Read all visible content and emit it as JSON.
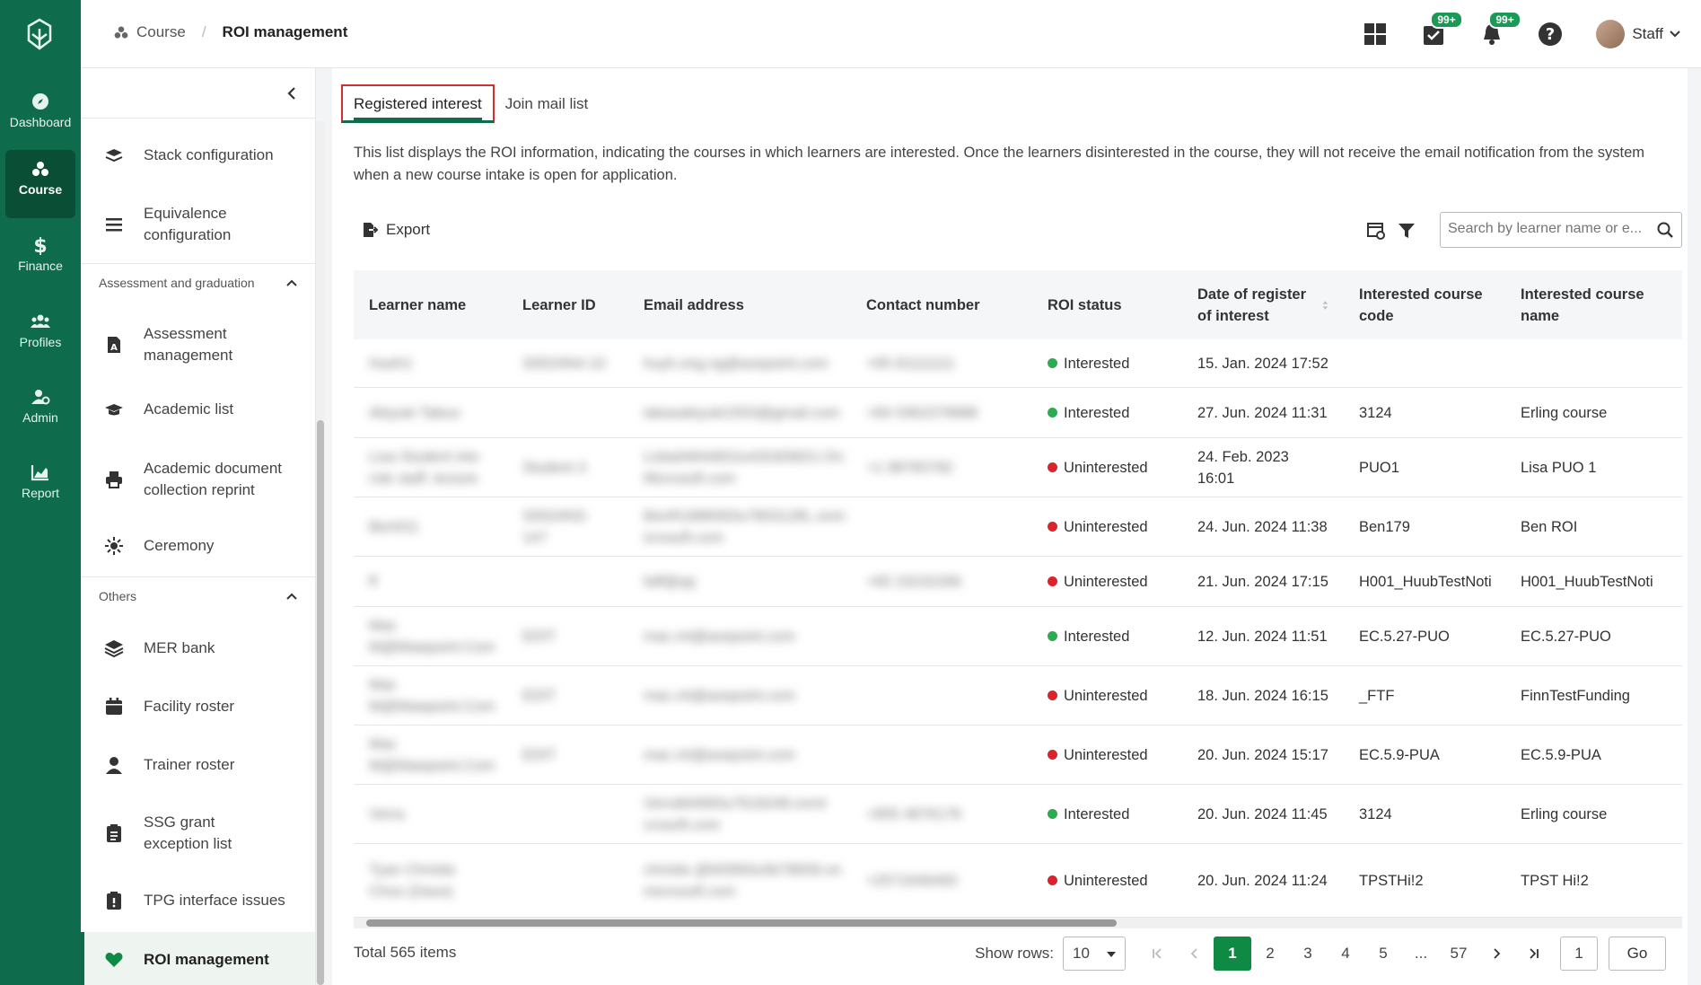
{
  "rail": {
    "items": [
      {
        "label": "Dashboard",
        "icon": "compass-icon"
      },
      {
        "label": "Course",
        "icon": "course-icon"
      },
      {
        "label": "Finance",
        "icon": "dollar-icon"
      },
      {
        "label": "Profiles",
        "icon": "people-icon"
      },
      {
        "label": "Admin",
        "icon": "admin-icon"
      },
      {
        "label": "Report",
        "icon": "chart-icon"
      }
    ]
  },
  "breadcrumb": {
    "root": "Course",
    "current": "ROI management"
  },
  "header": {
    "badge_tasks": "99+",
    "badge_notifications": "99+",
    "user_name": "Staff"
  },
  "subnav": {
    "items": [
      {
        "label": "Stack configuration"
      },
      {
        "label": "Equivalence configuration"
      },
      {
        "label": "Assessment management"
      },
      {
        "label": "Academic list"
      },
      {
        "label": "Academic document collection reprint"
      },
      {
        "label": "Ceremony"
      },
      {
        "label": "MER bank"
      },
      {
        "label": "Facility roster"
      },
      {
        "label": "Trainer roster"
      },
      {
        "label": "SSG grant exception list"
      },
      {
        "label": "TPG interface issues"
      },
      {
        "label": "ROI management"
      }
    ],
    "sections": [
      "Assessment and graduation",
      "Others"
    ]
  },
  "tabs": [
    "Registered interest",
    "Join mail list"
  ],
  "description": "This list displays the ROI information, indicating the courses in which learners are interested. Once the learners disinterested in the course, they will not receive the email notification from the system when a new course intake is open for application.",
  "toolbar": {
    "export_label": "Export",
    "search_placeholder": "Search by learner name or e..."
  },
  "table": {
    "columns": [
      "Learner name",
      "Learner ID",
      "Email address",
      "Contact number",
      "ROI status",
      "Date of register of interest",
      "Interested course code",
      "Interested course name"
    ],
    "rows": [
      {
        "name": "Hueh1",
        "id": "S0024N4-10",
        "email": "huyh.ong.ng@axepoint.com",
        "contact": "+65 81111111",
        "status": "Interested",
        "date": "15. Jan. 2024 17:52",
        "code": "",
        "course": ""
      },
      {
        "name": "Akiyuki Tabuo",
        "id": "",
        "email": "takasakiyuki1503@gmail.com",
        "contact": "+84 0362379988",
        "status": "Interested",
        "date": "27. Jun. 2024 11:31",
        "code": "3124",
        "course": "Erling course"
      },
      {
        "name": "Lisa Student into role staff, lecture",
        "id": "Student 3",
        "email": "LisbahM4483Ju43G8382U.On Microsoft.com",
        "contact": "+1 98765782",
        "status": "Uninterested",
        "date": "24. Feb. 2023 16:01",
        "code": "PUO1",
        "course": "Lisa PUO 1"
      },
      {
        "name": "Ben011",
        "id": "S0024N3-147",
        "email": "BenR1886583u7803128L.onm icrosoft.com",
        "contact": "",
        "status": "Uninterested",
        "date": "24. Jun. 2024 11:38",
        "code": "Ben179",
        "course": "Ben ROI"
      },
      {
        "name": "ff",
        "id": "",
        "email": "faff@qq",
        "contact": "+65 23232266",
        "status": "Uninterested",
        "date": "21. Jun. 2024 17:15",
        "code": "H001_HuubTestNoti",
        "course": "H001_HuubTestNoti"
      },
      {
        "name": "Mac M@Mawpoint.Com",
        "id": "EDIT",
        "email": "mac.mt@axepoint.com",
        "contact": "",
        "status": "Interested",
        "date": "12. Jun. 2024 11:51",
        "code": "EC.5.27-PUO",
        "course": "EC.5.27-PUO"
      },
      {
        "name": "Mac M@Mawpoint.Com",
        "id": "EDIT",
        "email": "mac.mt@axepoint.com",
        "contact": "",
        "status": "Uninterested",
        "date": "18. Jun. 2024 16:15",
        "code": "_FTF",
        "course": "FinnTestFunding"
      },
      {
        "name": "Mac M@Mawpoint.Com",
        "id": "EDIT",
        "email": "mac.mt@axepoint.com",
        "contact": "",
        "status": "Uninterested",
        "date": "20. Jun. 2024 15:17",
        "code": "EC.5.9-PUA",
        "course": "EC.5.9-PUA"
      },
      {
        "name": "Verra",
        "id": "",
        "email": "VerraM4993u7618248.onmi crosoft.com",
        "contact": "+855 4876176",
        "status": "Interested",
        "date": "20. Jun. 2024 11:45",
        "code": "3124",
        "course": "Erling course"
      },
      {
        "name": "Tyan Christie Choo (Dave)",
        "id": "",
        "email": "christie.@M3993u5b78659.on microsoft.com",
        "contact": "+2571646493",
        "status": "Uninterested",
        "date": "20. Jun. 2024 11:24",
        "code": "TPSTHi!2",
        "course": "TPST Hi!2"
      }
    ]
  },
  "footer": {
    "total": "Total 565 items",
    "show_rows_label": "Show rows:",
    "rows_value": "10",
    "pages": [
      "1",
      "2",
      "3",
      "4",
      "5",
      "...",
      "57"
    ],
    "goto_value": "1",
    "go_label": "Go"
  },
  "colors": {
    "rail": "#0e6b4b",
    "accent": "#0e8a45",
    "interested": "#2eaa55",
    "uninterested": "#d8252b",
    "tab_highlight": "#d32f2f"
  }
}
